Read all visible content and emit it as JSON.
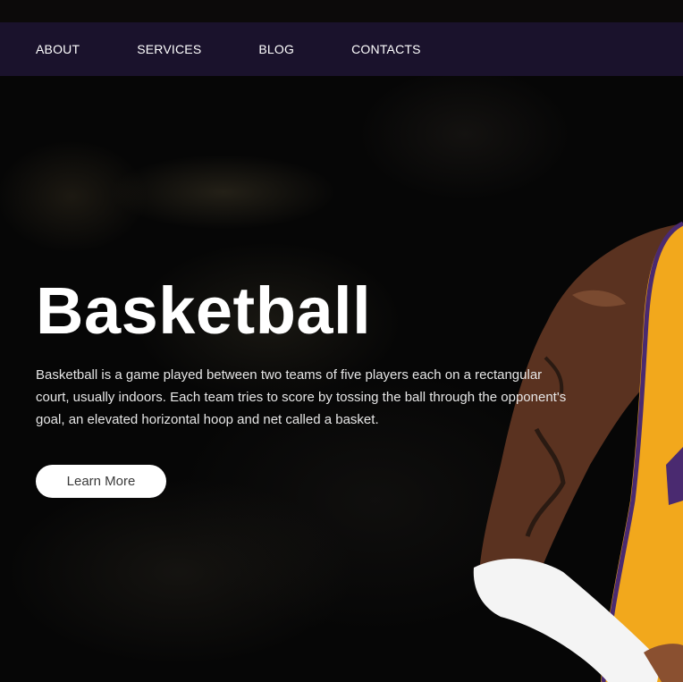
{
  "nav": {
    "items": [
      {
        "label": "ABOUT"
      },
      {
        "label": "SERVICES"
      },
      {
        "label": "BLOG"
      },
      {
        "label": "CONTACTS"
      }
    ]
  },
  "hero": {
    "title": "Basketball",
    "description": "Basketball is a game played between two teams of five players each on a rectangular court, usually indoors. Each team tries to score by tossing the ball through the opponent's goal, an elevated horizontal hoop and net called a basket.",
    "cta_label": "Learn More",
    "image_icon": "basketball-player-image"
  },
  "colors": {
    "navbar": "#1c1330",
    "jersey": "#f2a81c",
    "background": "#060606",
    "button": "#ffffff"
  }
}
